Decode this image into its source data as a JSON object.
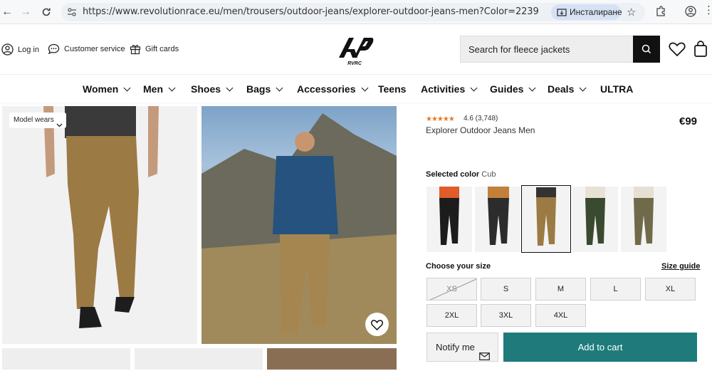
{
  "browser": {
    "url": "https://www.revolutionrace.eu/men/trousers/outdoor-jeans/explorer-outdoor-jeans-men?Color=2239",
    "install_label": "Инсталиране"
  },
  "header": {
    "login_label": "Log in",
    "customer_service_label": "Customer service",
    "gift_cards_label": "Gift cards",
    "logo_text": "RVRC",
    "search_placeholder": "Search for fleece jackets"
  },
  "menu": {
    "items": [
      {
        "label": "Women",
        "dropdown": true
      },
      {
        "label": "Men",
        "dropdown": true
      },
      {
        "label": "Shoes",
        "dropdown": true
      },
      {
        "label": "Bags",
        "dropdown": true
      },
      {
        "label": "Accessories",
        "dropdown": true
      },
      {
        "label": "Teens",
        "dropdown": false
      },
      {
        "label": "Activities",
        "dropdown": true
      },
      {
        "label": "Guides",
        "dropdown": true
      },
      {
        "label": "Deals",
        "dropdown": true
      },
      {
        "label": "ULTRA",
        "dropdown": false
      }
    ]
  },
  "gallery": {
    "model_wears_label": "Model wears"
  },
  "product": {
    "rating_text": "4.6 (3,748)",
    "stars": "★★★★★",
    "name": "Explorer Outdoor Jeans Men",
    "price": "€99",
    "selected_color_label": "Selected color",
    "selected_color_value": "Cub",
    "size_title": "Choose your size",
    "size_guide": "Size guide",
    "sizes": [
      "XS",
      "S",
      "M",
      "L",
      "XL",
      "2XL",
      "3XL",
      "4XL"
    ],
    "notify_label": "Notify me",
    "add_to_cart_label": "Add to cart"
  },
  "colors": {
    "accent": "#1f7b7b",
    "star": "#e07b2a"
  }
}
